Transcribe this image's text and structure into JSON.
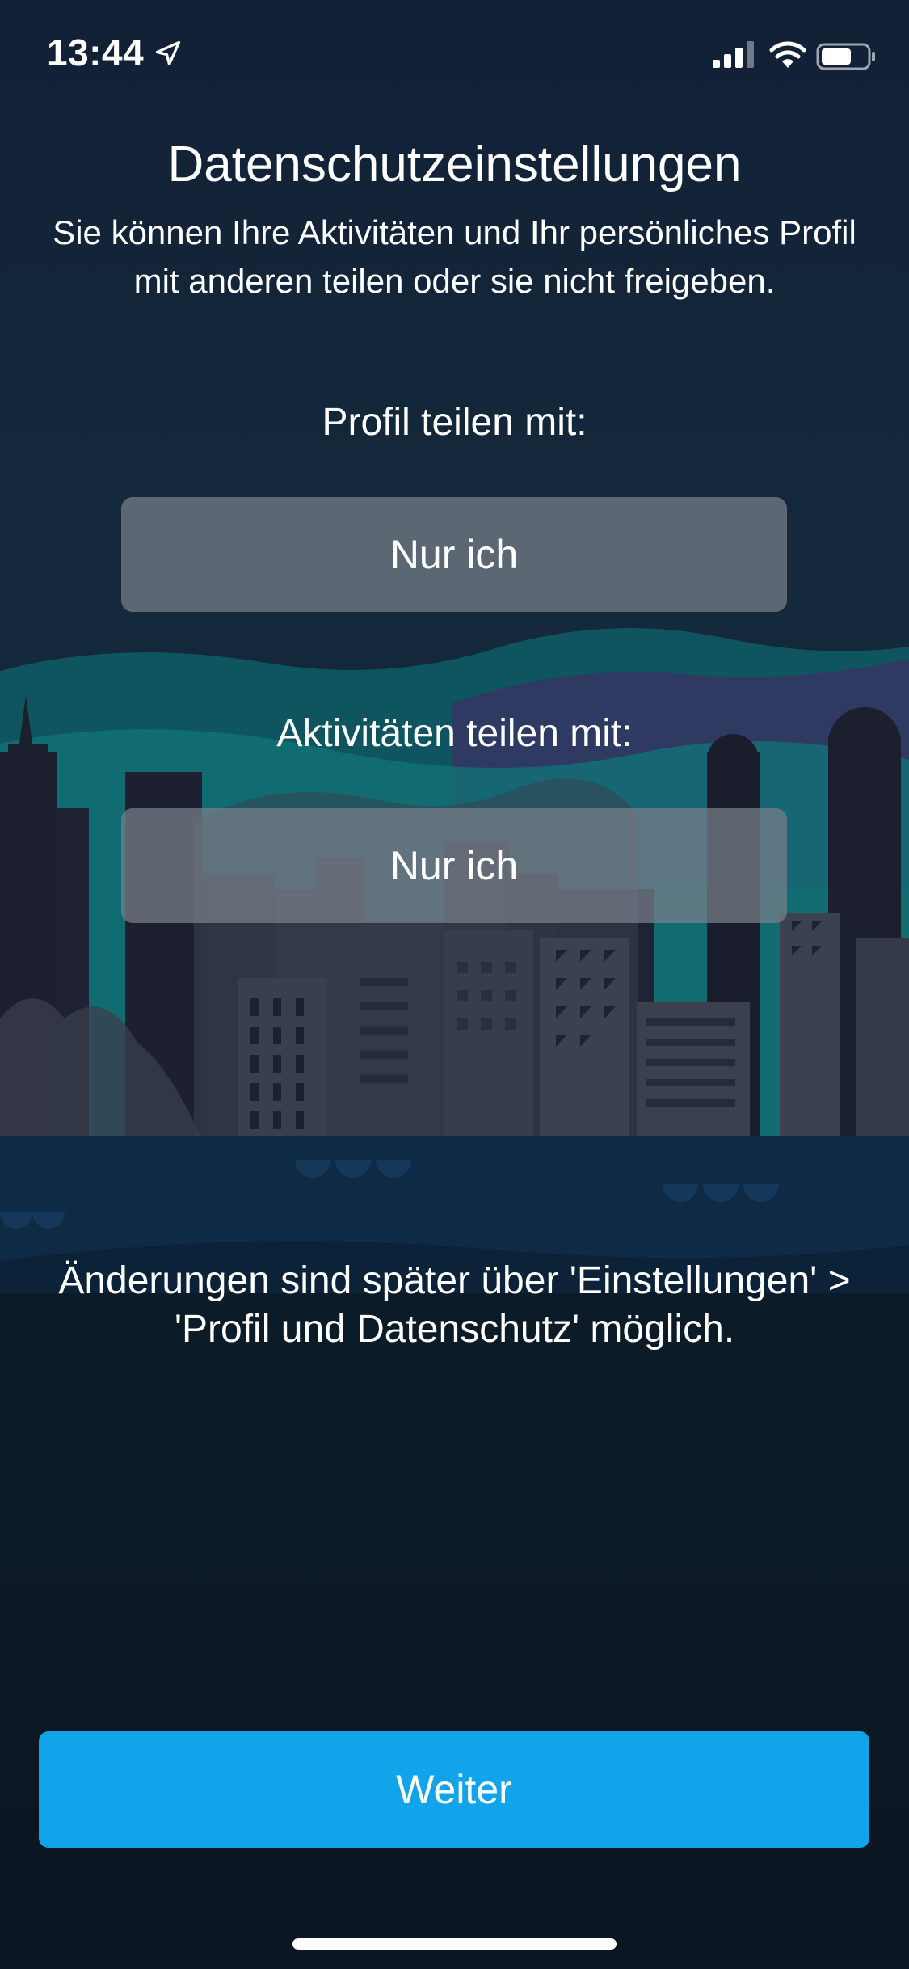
{
  "status_bar": {
    "time": "13:44",
    "location_icon": "location-arrow-icon",
    "signal_icon": "cellular-signal-icon",
    "wifi_icon": "wifi-icon",
    "battery_icon": "battery-icon"
  },
  "header": {
    "title": "Datenschutzeinstellungen",
    "subtitle": "Sie können Ihre Aktivitäten und Ihr persönliches Profil mit anderen teilen oder sie nicht freigeben."
  },
  "profile_sharing": {
    "label": "Profil teilen mit:",
    "selected_value": "Nur ich"
  },
  "activity_sharing": {
    "label": "Aktivitäten teilen mit:",
    "selected_value": "Nur ich"
  },
  "note": "Änderungen sind später über 'Einstellungen' > 'Profil und Datenschutz' möglich.",
  "continue_button": {
    "label": "Weiter"
  },
  "colors": {
    "accent": "#12a4ea",
    "background": "#122036",
    "select_background": "#787f8a"
  }
}
